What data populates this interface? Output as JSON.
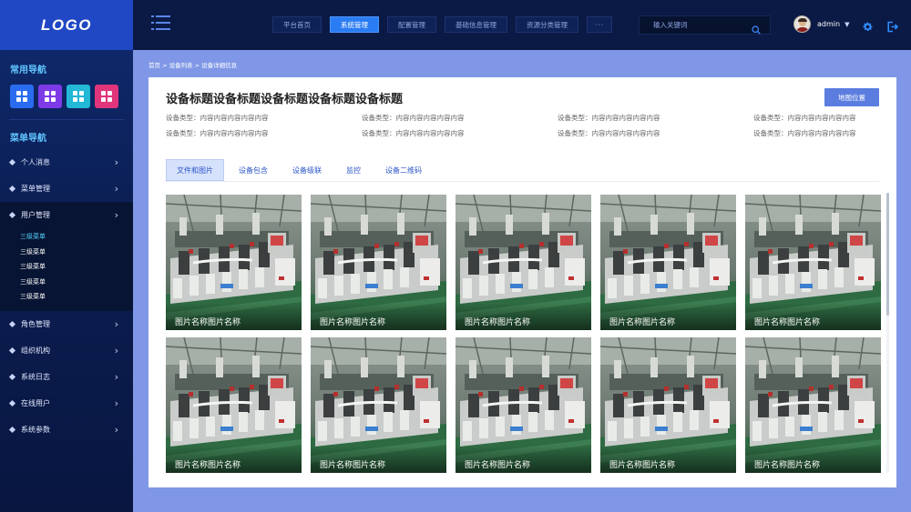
{
  "sidebar": {
    "logo": "LOGO",
    "common_title": "常用导航",
    "quick": [
      {
        "name": "quick-app-1",
        "color": "#2a6cf0"
      },
      {
        "name": "quick-app-2",
        "color": "#7d3be8"
      },
      {
        "name": "quick-app-3",
        "color": "#22b8d6"
      },
      {
        "name": "quick-app-4",
        "color": "#e0357a"
      }
    ],
    "menu_title": "菜单导航",
    "items_top": [
      {
        "label": "个人消息"
      },
      {
        "label": "菜单管理"
      },
      {
        "label": "用户管理"
      }
    ],
    "submenu": [
      {
        "label": "三级菜单"
      },
      {
        "label": "三级菜单"
      },
      {
        "label": "三级菜单"
      },
      {
        "label": "三级菜单"
      },
      {
        "label": "三级菜单"
      }
    ],
    "items_bottom": [
      {
        "label": "角色管理"
      },
      {
        "label": "组织机构"
      },
      {
        "label": "系统日志"
      },
      {
        "label": "在线用户"
      },
      {
        "label": "系统参数"
      }
    ]
  },
  "topbar": {
    "tabs": [
      {
        "label": "平台首页"
      },
      {
        "label": "系统管理"
      },
      {
        "label": "配置管理"
      },
      {
        "label": "基础信息管理"
      },
      {
        "label": "资源分类管理"
      }
    ],
    "more_label": "···",
    "search_placeholder": "输入关键词",
    "username": "admin"
  },
  "breadcrumb": "首页 > 设备列表 > 设备详细信息",
  "detail": {
    "title": "设备标题设备标题设备标题设备标题设备标题",
    "map_button": "地图位置",
    "info": [
      {
        "key": "设备类型：",
        "value": "内容内容内容内容内容"
      },
      {
        "key": "设备类型：",
        "value": "内容内容内容内容内容"
      },
      {
        "key": "设备类型：",
        "value": "内容内容内容内容内容"
      },
      {
        "key": "设备类型：",
        "value": "内容内容内容内容内容"
      },
      {
        "key": "设备类型：",
        "value": "内容内容内容内容内容"
      },
      {
        "key": "设备类型：",
        "value": "内容内容内容内容内容"
      },
      {
        "key": "设备类型：",
        "value": "内容内容内容内容内容"
      },
      {
        "key": "设备类型：",
        "value": "内容内容内容内容内容"
      }
    ],
    "tabs": [
      {
        "label": "文件和图片"
      },
      {
        "label": "设备包含"
      },
      {
        "label": "设备级联"
      },
      {
        "label": "监控"
      },
      {
        "label": "设备二维码"
      }
    ],
    "images": [
      {
        "caption": "图片名称图片名称"
      },
      {
        "caption": "图片名称图片名称"
      },
      {
        "caption": "图片名称图片名称"
      },
      {
        "caption": "图片名称图片名称"
      },
      {
        "caption": "图片名称图片名称"
      },
      {
        "caption": "图片名称图片名称"
      },
      {
        "caption": "图片名称图片名称"
      },
      {
        "caption": "图片名称图片名称"
      },
      {
        "caption": "图片名称图片名称"
      },
      {
        "caption": "图片名称图片名称"
      }
    ]
  },
  "colors": {
    "accent": "#2a7cf3",
    "sidebar_bg": "#0b1e52",
    "page_bg": "#7f97e6",
    "active_sub": "#54d4ff"
  },
  "icons": [
    "menu-icon",
    "search-icon",
    "gear-icon",
    "logout-icon",
    "chevron-right-icon",
    "grid-icon"
  ]
}
